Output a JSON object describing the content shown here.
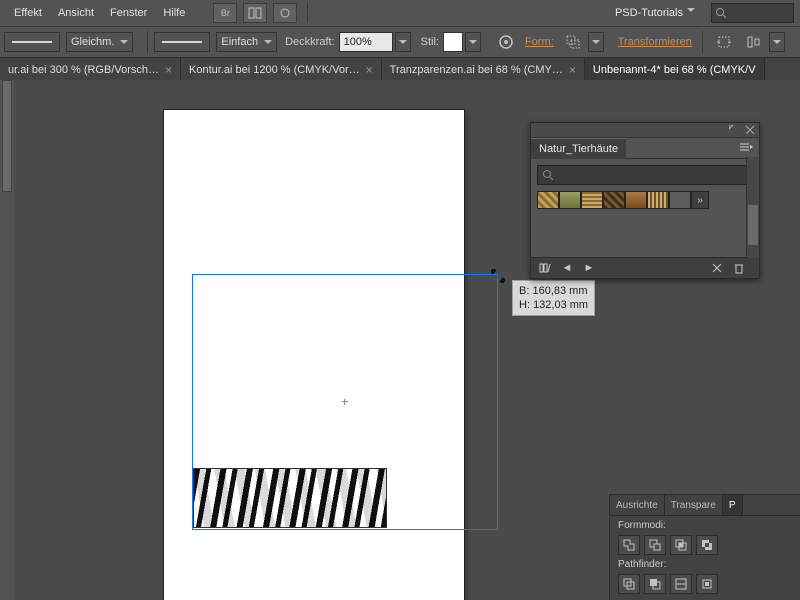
{
  "menubar": {
    "items": [
      "Effekt",
      "Ansicht",
      "Fenster",
      "Hilfe"
    ],
    "psd": "PSD-Tutorials"
  },
  "options": {
    "stroke_mode": "Gleichm.",
    "brush_mode": "Einfach",
    "opacity_label": "Deckkraft:",
    "opacity_value": "100%",
    "style_label": "Stil:",
    "form_label": "Form:",
    "transform_label": "Transformieren"
  },
  "tabs": [
    {
      "label": "ur.ai bei 300 % (RGB/Vorsch…",
      "active": false
    },
    {
      "label": "Kontur.ai bei 1200 % (CMYK/Vor…",
      "active": false
    },
    {
      "label": "Tranzparenzen.ai bei 68 % (CMY…",
      "active": false
    },
    {
      "label": "Unbenannt-4* bei 68 % (CMYK/V",
      "active": true
    }
  ],
  "tooltip": {
    "w_label": "B:",
    "w_val": "160,83 mm",
    "h_label": "H:",
    "h_val": "132,03 mm"
  },
  "panel": {
    "title": "Natur_Tierhäute"
  },
  "dock": {
    "tabs": [
      "Ausrichte",
      "Transpare",
      "P"
    ],
    "sections": [
      {
        "label": "Formmodi:"
      },
      {
        "label": "Pathfinder:"
      }
    ]
  }
}
